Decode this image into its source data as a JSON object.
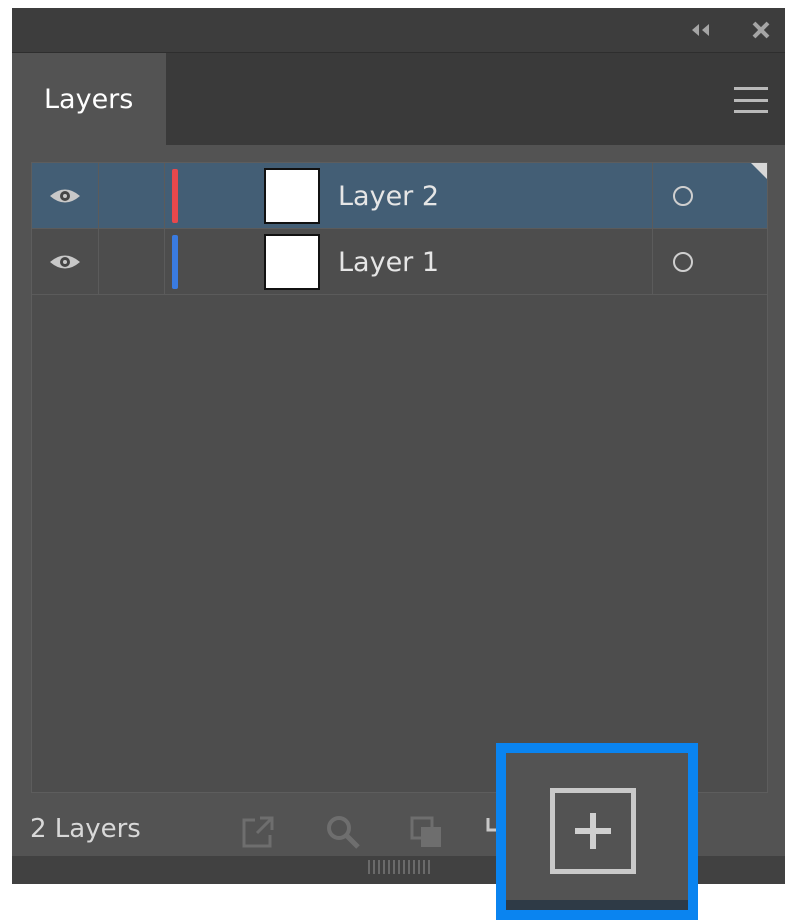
{
  "panel": {
    "tab_label": "Layers",
    "layer_count": "2 Layers"
  },
  "layers": [
    {
      "name": "Layer 2",
      "color": "#e8484c",
      "selected": true,
      "visible": true
    },
    {
      "name": "Layer 1",
      "color": "#3a7be0",
      "selected": false,
      "visible": true
    }
  ],
  "icons": {
    "collapse": "double-chevron-left-icon",
    "close": "close-icon",
    "menu": "hamburger-menu-icon",
    "visibility": "eye-icon",
    "target": "target-circle-icon",
    "export": "export-icon",
    "search": "search-icon",
    "clipping_mask": "clipping-mask-icon",
    "new_sublayer": "new-sublayer-icon",
    "new_layer": "new-layer-plus-icon"
  },
  "colors": {
    "highlight": "#0a84f0",
    "selected_row": "#435e75"
  }
}
